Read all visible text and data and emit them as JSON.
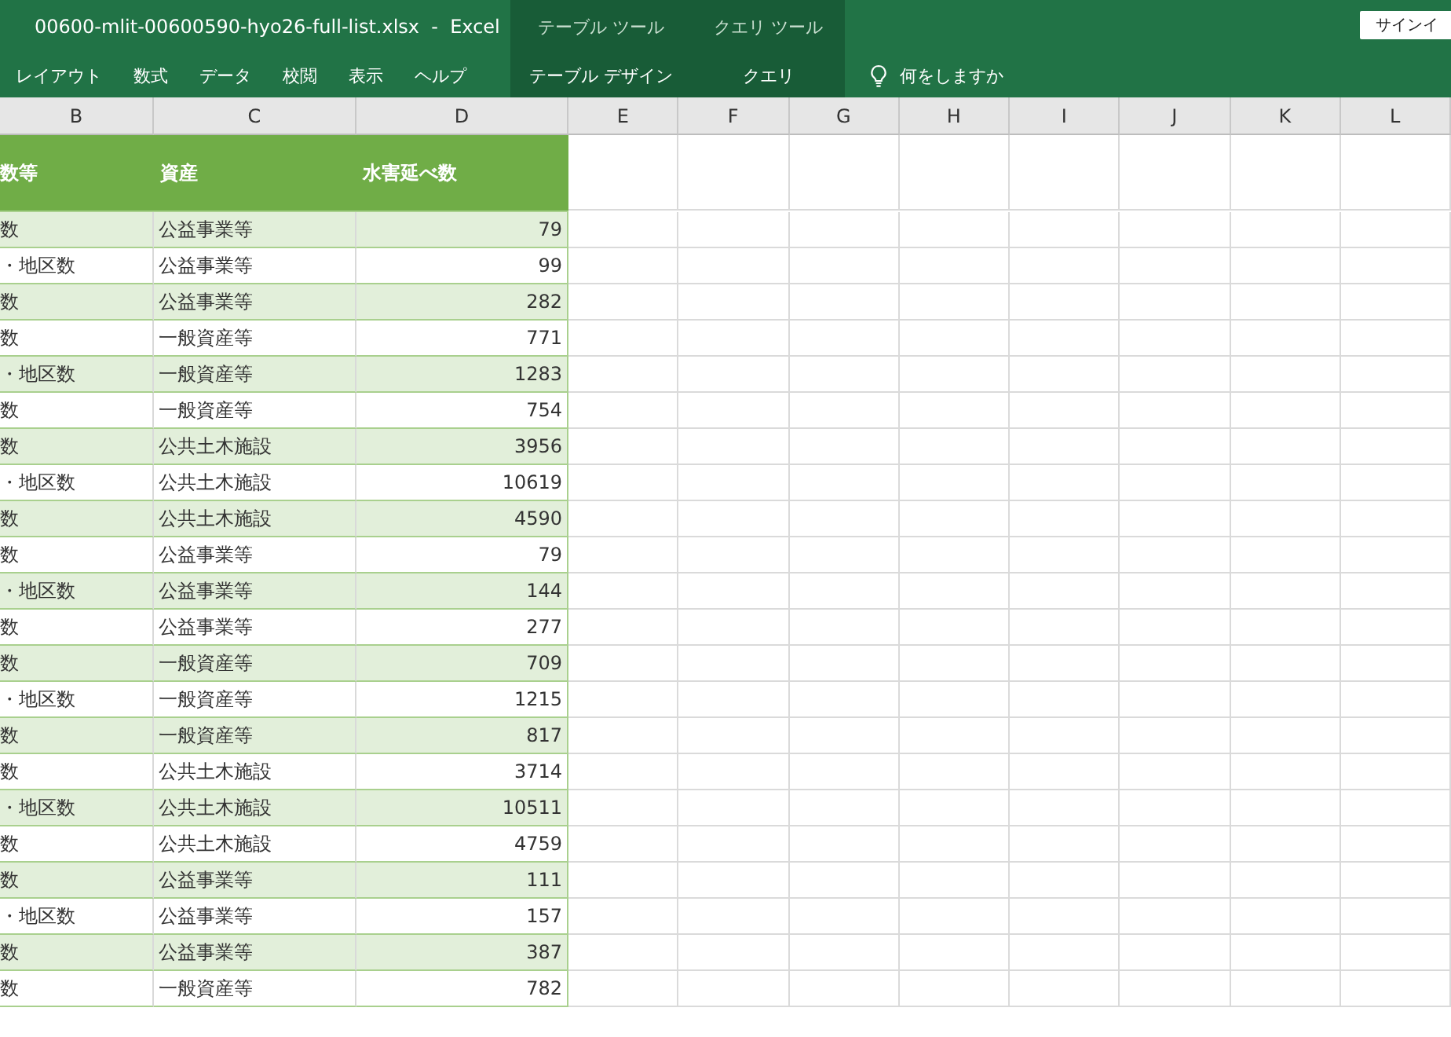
{
  "window": {
    "title": "00600-mlit-00600590-hyo26-full-list.xlsx  -  Excel",
    "sign_in": "サインイ"
  },
  "ribbon": {
    "tabs": [
      {
        "label": "レイアウト",
        "selected": false
      },
      {
        "label": "数式",
        "selected": false
      },
      {
        "label": "データ",
        "selected": false
      },
      {
        "label": "校閲",
        "selected": false
      },
      {
        "label": "表示",
        "selected": false
      },
      {
        "label": "ヘルプ",
        "selected": false
      }
    ],
    "context_groups": [
      {
        "label": "テーブル ツール",
        "tabs": [
          {
            "label": "テーブル デザイン",
            "selected": false
          }
        ]
      },
      {
        "label": "クエリ ツール",
        "tabs": [
          {
            "label": "クエリ",
            "selected": false
          }
        ]
      }
    ],
    "tell_me": "何をしますか"
  },
  "columns": [
    "B",
    "C",
    "D",
    "E",
    "F",
    "G",
    "H",
    "I",
    "J",
    "K",
    "L"
  ],
  "table": {
    "headers": [
      "数等",
      "資産",
      "水害延べ数"
    ],
    "rows": [
      {
        "cells": [
          "数",
          "公益事業等",
          "79"
        ],
        "banded": true
      },
      {
        "cells": [
          "・地区数",
          "公益事業等",
          "99"
        ],
        "banded": false
      },
      {
        "cells": [
          "数",
          "公益事業等",
          "282"
        ],
        "banded": true
      },
      {
        "cells": [
          "数",
          "一般資産等",
          "771"
        ],
        "banded": false
      },
      {
        "cells": [
          "・地区数",
          "一般資産等",
          "1283"
        ],
        "banded": true
      },
      {
        "cells": [
          "数",
          "一般資産等",
          "754"
        ],
        "banded": false
      },
      {
        "cells": [
          "数",
          "公共土木施設",
          "3956"
        ],
        "banded": true
      },
      {
        "cells": [
          "・地区数",
          "公共土木施設",
          "10619"
        ],
        "banded": false
      },
      {
        "cells": [
          "数",
          "公共土木施設",
          "4590"
        ],
        "banded": true
      },
      {
        "cells": [
          "数",
          "公益事業等",
          "79"
        ],
        "banded": false
      },
      {
        "cells": [
          "・地区数",
          "公益事業等",
          "144"
        ],
        "banded": true
      },
      {
        "cells": [
          "数",
          "公益事業等",
          "277"
        ],
        "banded": false
      },
      {
        "cells": [
          "数",
          "一般資産等",
          "709"
        ],
        "banded": true
      },
      {
        "cells": [
          "・地区数",
          "一般資産等",
          "1215"
        ],
        "banded": false
      },
      {
        "cells": [
          "数",
          "一般資産等",
          "817"
        ],
        "banded": true
      },
      {
        "cells": [
          "数",
          "公共土木施設",
          "3714"
        ],
        "banded": false
      },
      {
        "cells": [
          "・地区数",
          "公共土木施設",
          "10511"
        ],
        "banded": true
      },
      {
        "cells": [
          "数",
          "公共土木施設",
          "4759"
        ],
        "banded": false
      },
      {
        "cells": [
          "数",
          "公益事業等",
          "111"
        ],
        "banded": true
      },
      {
        "cells": [
          "・地区数",
          "公益事業等",
          "157"
        ],
        "banded": false
      },
      {
        "cells": [
          "数",
          "公益事業等",
          "387"
        ],
        "banded": true
      },
      {
        "cells": [
          "数",
          "一般資産等",
          "782"
        ],
        "banded": false
      }
    ]
  }
}
